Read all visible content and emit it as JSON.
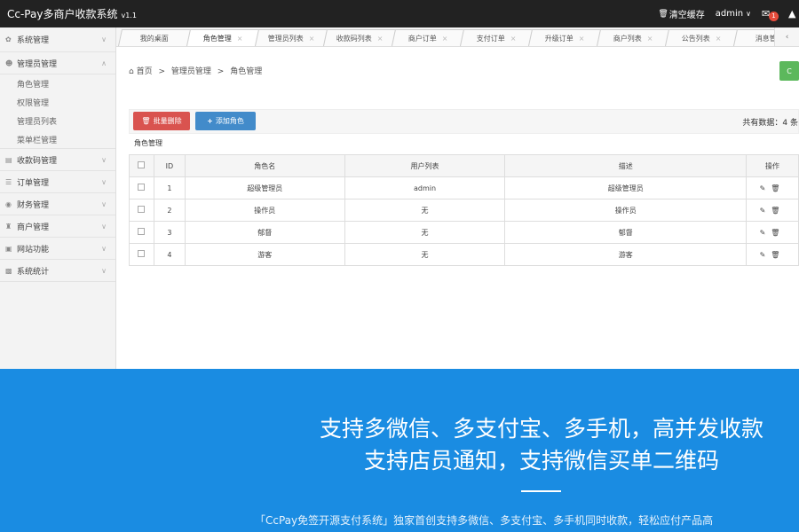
{
  "app": {
    "title": "Cc-Pay多商户收款系统",
    "version": "v1.1"
  },
  "topbar": {
    "clear_cache": "清空缓存",
    "user": "admin",
    "mail_count": "1"
  },
  "sidebar": {
    "items": [
      {
        "label": "系统管理"
      },
      {
        "label": "管理员管理"
      },
      {
        "label": "收款码管理"
      },
      {
        "label": "订单管理"
      },
      {
        "label": "财务管理"
      },
      {
        "label": "商户管理"
      },
      {
        "label": "网站功能"
      },
      {
        "label": "系统统计"
      }
    ],
    "subitems": [
      {
        "label": "角色管理"
      },
      {
        "label": "权限管理"
      },
      {
        "label": "管理员列表"
      },
      {
        "label": "菜单栏管理"
      }
    ]
  },
  "tabs": [
    {
      "label": "我的桌面"
    },
    {
      "label": "角色管理"
    },
    {
      "label": "管理员列表"
    },
    {
      "label": "收款码列表"
    },
    {
      "label": "商户订单"
    },
    {
      "label": "支付订单"
    },
    {
      "label": "升级订单"
    },
    {
      "label": "商户列表"
    },
    {
      "label": "公告列表"
    },
    {
      "label": "消息管理"
    }
  ],
  "breadcrumb": {
    "home": "首页",
    "sep": ">",
    "level1": "管理员管理",
    "level2": "角色管理"
  },
  "actions": {
    "batch_delete": "批量删除",
    "add_role": "添加角色",
    "total": "共有数据：4 条"
  },
  "table": {
    "title": "角色管理",
    "headers": [
      "ID",
      "角色名",
      "用户列表",
      "描述",
      "操作"
    ],
    "rows": [
      {
        "id": "1",
        "name": "超级管理员",
        "users": "admin",
        "desc": "超级管理员"
      },
      {
        "id": "2",
        "name": "操作员",
        "users": "无",
        "desc": "操作员"
      },
      {
        "id": "3",
        "name": "郁督",
        "users": "无",
        "desc": "郁督"
      },
      {
        "id": "4",
        "name": "游客",
        "users": "无",
        "desc": "游客"
      }
    ]
  },
  "banner": {
    "line1": "支持多微信、多支付宝、多手机，高并发收款",
    "line2": "支持店员通知，支持微信买单二维码",
    "tagline": "「CcPay免签开源支付系统」独家首创支持多微信、多支付宝、多手机同时收款，轻松应付产品高"
  }
}
